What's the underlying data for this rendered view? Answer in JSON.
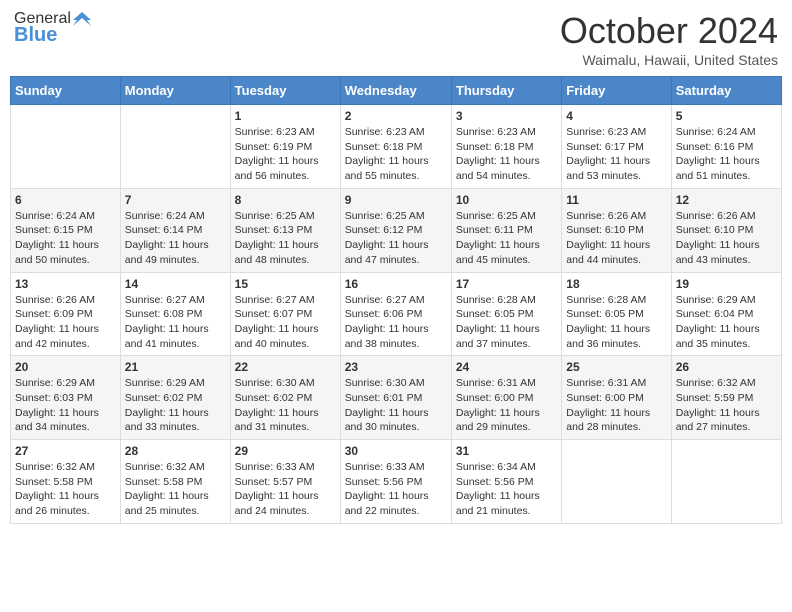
{
  "header": {
    "logo_general": "General",
    "logo_blue": "Blue",
    "month_title": "October 2024",
    "subtitle": "Waimalu, Hawaii, United States"
  },
  "days_of_week": [
    "Sunday",
    "Monday",
    "Tuesday",
    "Wednesday",
    "Thursday",
    "Friday",
    "Saturday"
  ],
  "weeks": [
    [
      {
        "day": "",
        "info": ""
      },
      {
        "day": "",
        "info": ""
      },
      {
        "day": "1",
        "info": "Sunrise: 6:23 AM\nSunset: 6:19 PM\nDaylight: 11 hours and 56 minutes."
      },
      {
        "day": "2",
        "info": "Sunrise: 6:23 AM\nSunset: 6:18 PM\nDaylight: 11 hours and 55 minutes."
      },
      {
        "day": "3",
        "info": "Sunrise: 6:23 AM\nSunset: 6:18 PM\nDaylight: 11 hours and 54 minutes."
      },
      {
        "day": "4",
        "info": "Sunrise: 6:23 AM\nSunset: 6:17 PM\nDaylight: 11 hours and 53 minutes."
      },
      {
        "day": "5",
        "info": "Sunrise: 6:24 AM\nSunset: 6:16 PM\nDaylight: 11 hours and 51 minutes."
      }
    ],
    [
      {
        "day": "6",
        "info": "Sunrise: 6:24 AM\nSunset: 6:15 PM\nDaylight: 11 hours and 50 minutes."
      },
      {
        "day": "7",
        "info": "Sunrise: 6:24 AM\nSunset: 6:14 PM\nDaylight: 11 hours and 49 minutes."
      },
      {
        "day": "8",
        "info": "Sunrise: 6:25 AM\nSunset: 6:13 PM\nDaylight: 11 hours and 48 minutes."
      },
      {
        "day": "9",
        "info": "Sunrise: 6:25 AM\nSunset: 6:12 PM\nDaylight: 11 hours and 47 minutes."
      },
      {
        "day": "10",
        "info": "Sunrise: 6:25 AM\nSunset: 6:11 PM\nDaylight: 11 hours and 45 minutes."
      },
      {
        "day": "11",
        "info": "Sunrise: 6:26 AM\nSunset: 6:10 PM\nDaylight: 11 hours and 44 minutes."
      },
      {
        "day": "12",
        "info": "Sunrise: 6:26 AM\nSunset: 6:10 PM\nDaylight: 11 hours and 43 minutes."
      }
    ],
    [
      {
        "day": "13",
        "info": "Sunrise: 6:26 AM\nSunset: 6:09 PM\nDaylight: 11 hours and 42 minutes."
      },
      {
        "day": "14",
        "info": "Sunrise: 6:27 AM\nSunset: 6:08 PM\nDaylight: 11 hours and 41 minutes."
      },
      {
        "day": "15",
        "info": "Sunrise: 6:27 AM\nSunset: 6:07 PM\nDaylight: 11 hours and 40 minutes."
      },
      {
        "day": "16",
        "info": "Sunrise: 6:27 AM\nSunset: 6:06 PM\nDaylight: 11 hours and 38 minutes."
      },
      {
        "day": "17",
        "info": "Sunrise: 6:28 AM\nSunset: 6:05 PM\nDaylight: 11 hours and 37 minutes."
      },
      {
        "day": "18",
        "info": "Sunrise: 6:28 AM\nSunset: 6:05 PM\nDaylight: 11 hours and 36 minutes."
      },
      {
        "day": "19",
        "info": "Sunrise: 6:29 AM\nSunset: 6:04 PM\nDaylight: 11 hours and 35 minutes."
      }
    ],
    [
      {
        "day": "20",
        "info": "Sunrise: 6:29 AM\nSunset: 6:03 PM\nDaylight: 11 hours and 34 minutes."
      },
      {
        "day": "21",
        "info": "Sunrise: 6:29 AM\nSunset: 6:02 PM\nDaylight: 11 hours and 33 minutes."
      },
      {
        "day": "22",
        "info": "Sunrise: 6:30 AM\nSunset: 6:02 PM\nDaylight: 11 hours and 31 minutes."
      },
      {
        "day": "23",
        "info": "Sunrise: 6:30 AM\nSunset: 6:01 PM\nDaylight: 11 hours and 30 minutes."
      },
      {
        "day": "24",
        "info": "Sunrise: 6:31 AM\nSunset: 6:00 PM\nDaylight: 11 hours and 29 minutes."
      },
      {
        "day": "25",
        "info": "Sunrise: 6:31 AM\nSunset: 6:00 PM\nDaylight: 11 hours and 28 minutes."
      },
      {
        "day": "26",
        "info": "Sunrise: 6:32 AM\nSunset: 5:59 PM\nDaylight: 11 hours and 27 minutes."
      }
    ],
    [
      {
        "day": "27",
        "info": "Sunrise: 6:32 AM\nSunset: 5:58 PM\nDaylight: 11 hours and 26 minutes."
      },
      {
        "day": "28",
        "info": "Sunrise: 6:32 AM\nSunset: 5:58 PM\nDaylight: 11 hours and 25 minutes."
      },
      {
        "day": "29",
        "info": "Sunrise: 6:33 AM\nSunset: 5:57 PM\nDaylight: 11 hours and 24 minutes."
      },
      {
        "day": "30",
        "info": "Sunrise: 6:33 AM\nSunset: 5:56 PM\nDaylight: 11 hours and 22 minutes."
      },
      {
        "day": "31",
        "info": "Sunrise: 6:34 AM\nSunset: 5:56 PM\nDaylight: 11 hours and 21 minutes."
      },
      {
        "day": "",
        "info": ""
      },
      {
        "day": "",
        "info": ""
      }
    ]
  ]
}
